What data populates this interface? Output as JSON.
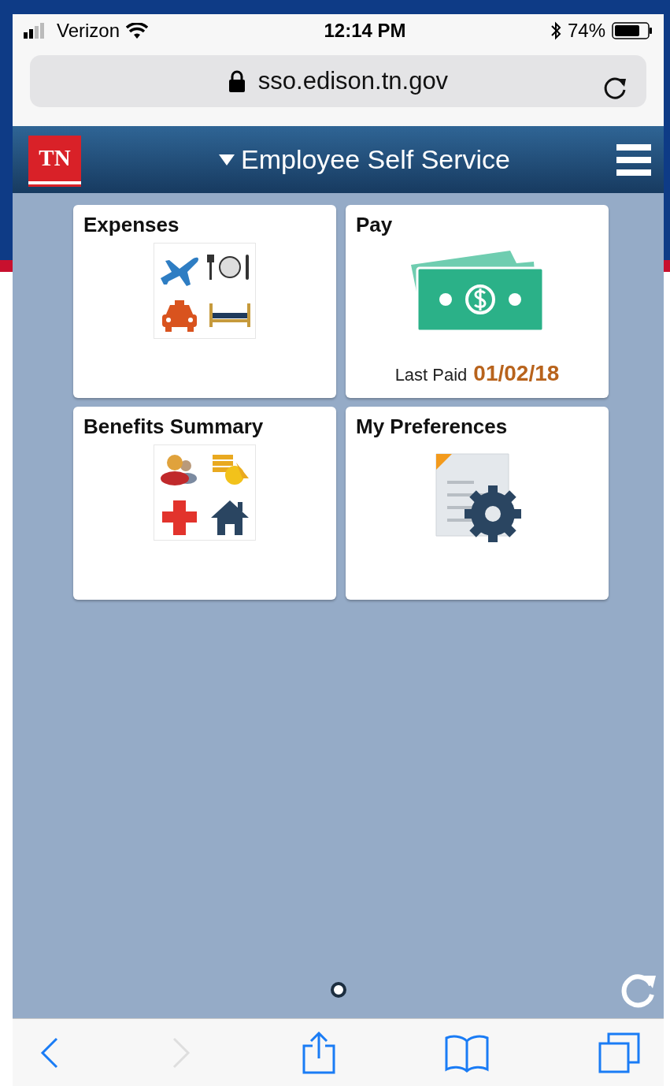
{
  "status_bar": {
    "carrier": "Verizon",
    "time": "12:14 PM",
    "battery": "74%"
  },
  "address_bar": {
    "url": "sso.edison.tn.gov"
  },
  "header": {
    "logo": "TN",
    "title": "Employee Self Service"
  },
  "tiles": [
    {
      "kind": "expenses",
      "title": "Expenses"
    },
    {
      "kind": "pay",
      "title": "Pay",
      "label": "Last Paid",
      "value": "01/02/18"
    },
    {
      "kind": "benefits",
      "title": "Benefits Summary"
    },
    {
      "kind": "preferences",
      "title": "My Preferences"
    }
  ],
  "page_dots": [
    {
      "selected": true
    }
  ],
  "toolbar": [
    {
      "kind": "back",
      "disabled": false
    },
    {
      "kind": "forward",
      "disabled": true
    },
    {
      "kind": "share",
      "disabled": false
    },
    {
      "kind": "bookmarks",
      "disabled": false
    },
    {
      "kind": "tabs",
      "disabled": false
    }
  ]
}
